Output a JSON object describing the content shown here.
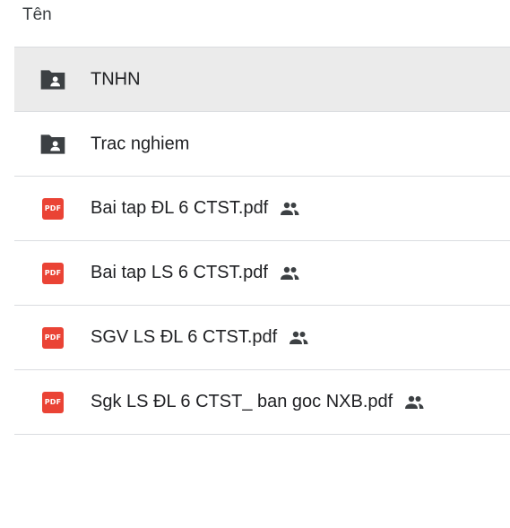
{
  "header": {
    "column_name": "Tên"
  },
  "colors": {
    "pdf": "#ea4335",
    "folder": "#3c4043",
    "selected_row": "#ebebeb",
    "divider": "#dadce0"
  },
  "items": [
    {
      "name": "TNHN",
      "type": "shared-folder",
      "icon": "shared-folder-icon",
      "selected": true,
      "shared": false
    },
    {
      "name": "Trac nghiem",
      "type": "shared-folder",
      "icon": "shared-folder-icon",
      "selected": false,
      "shared": false
    },
    {
      "name": "Bai tap ĐL 6 CTST.pdf",
      "type": "pdf",
      "icon": "pdf-icon",
      "badge": "PDF",
      "selected": false,
      "shared": true
    },
    {
      "name": "Bai tap LS 6 CTST.pdf",
      "type": "pdf",
      "icon": "pdf-icon",
      "badge": "PDF",
      "selected": false,
      "shared": true
    },
    {
      "name": "SGV LS ĐL 6 CTST.pdf",
      "type": "pdf",
      "icon": "pdf-icon",
      "badge": "PDF",
      "selected": false,
      "shared": true
    },
    {
      "name": "Sgk LS ĐL 6 CTST_ ban goc NXB.pdf",
      "type": "pdf",
      "icon": "pdf-icon",
      "badge": "PDF",
      "selected": false,
      "shared": true
    }
  ]
}
